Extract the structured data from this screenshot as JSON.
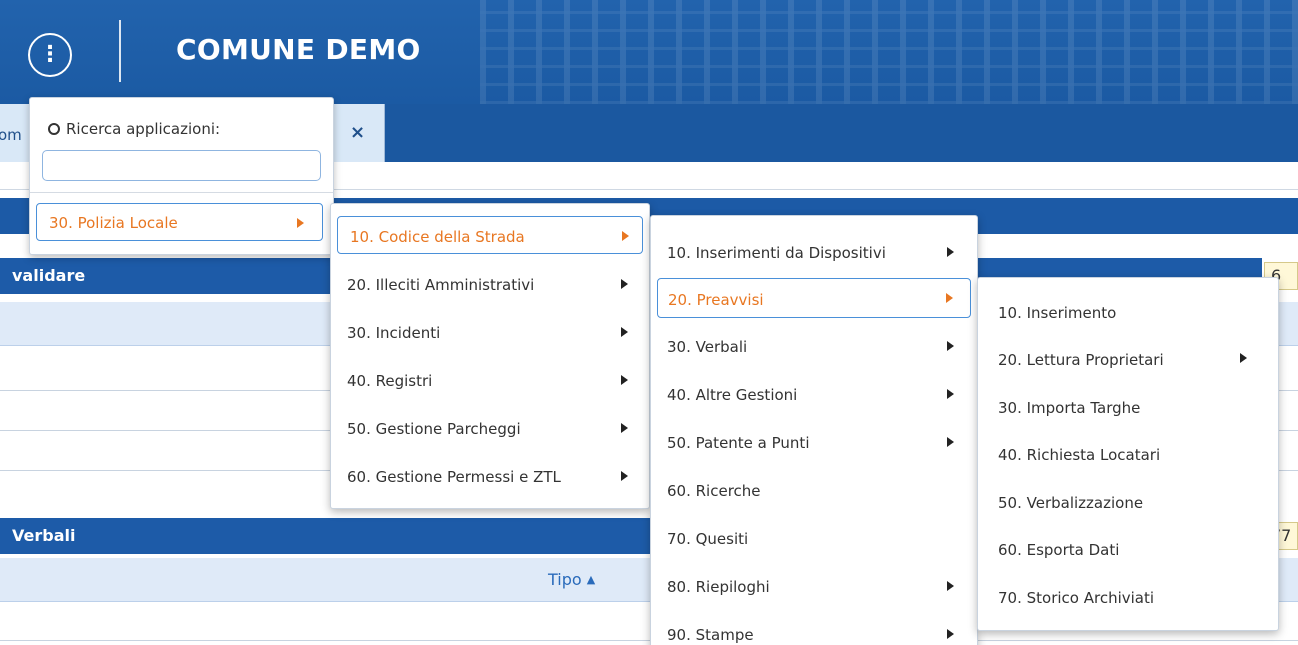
{
  "header": {
    "title": "COMUNE DEMO",
    "menu_icon": "dots-vertical-icon"
  },
  "tabs": [
    {
      "label": "om",
      "close": "×"
    }
  ],
  "sections": {
    "first_title": "validare",
    "first_badge": "6",
    "second_title": "Verbali",
    "second_badge": "77",
    "column_tipo": "Tipo",
    "sort_icon": "sort-icon"
  },
  "search": {
    "label": "Ricerca applicazioni:",
    "icon": "search-icon",
    "value": ""
  },
  "menu_level1": [
    {
      "label": "30. Polizia Locale",
      "active": true,
      "has_submenu": true
    }
  ],
  "menu_level2": [
    {
      "label": "10. Codice della Strada",
      "active": true,
      "has_submenu": true
    },
    {
      "label": "20. Illeciti Amministrativi",
      "has_submenu": true
    },
    {
      "label": "30. Incidenti",
      "has_submenu": true
    },
    {
      "label": "40. Registri",
      "has_submenu": true
    },
    {
      "label": "50. Gestione Parcheggi",
      "has_submenu": true
    },
    {
      "label": "60. Gestione Permessi e ZTL",
      "has_submenu": true
    }
  ],
  "menu_level3": [
    {
      "label": "10. Inserimenti da Dispositivi",
      "has_submenu": true
    },
    {
      "label": "20. Preavvisi",
      "active": true,
      "has_submenu": true
    },
    {
      "label": "30. Verbali",
      "has_submenu": true
    },
    {
      "label": "40. Altre Gestioni",
      "has_submenu": true
    },
    {
      "label": "50. Patente a Punti",
      "has_submenu": true
    },
    {
      "label": "60. Ricerche",
      "has_submenu": false
    },
    {
      "label": "70. Quesiti",
      "has_submenu": false
    },
    {
      "label": "80. Riepiloghi",
      "has_submenu": true
    },
    {
      "label": "90. Stampe",
      "has_submenu": true
    }
  ],
  "menu_level4": [
    {
      "label": "10. Inserimento",
      "has_submenu": false
    },
    {
      "label": "20. Lettura Proprietari",
      "has_submenu": true
    },
    {
      "label": "30. Importa Targhe",
      "has_submenu": false
    },
    {
      "label": "40. Richiesta Locatari",
      "has_submenu": false
    },
    {
      "label": "50. Verbalizzazione",
      "has_submenu": false
    },
    {
      "label": "60. Esporta Dati",
      "has_submenu": false
    },
    {
      "label": "70. Storico Archiviati",
      "has_submenu": false
    }
  ],
  "colors": {
    "brand_blue": "#1f5ea8",
    "active_orange": "#e87722",
    "focus_blue": "#4a90d9"
  }
}
